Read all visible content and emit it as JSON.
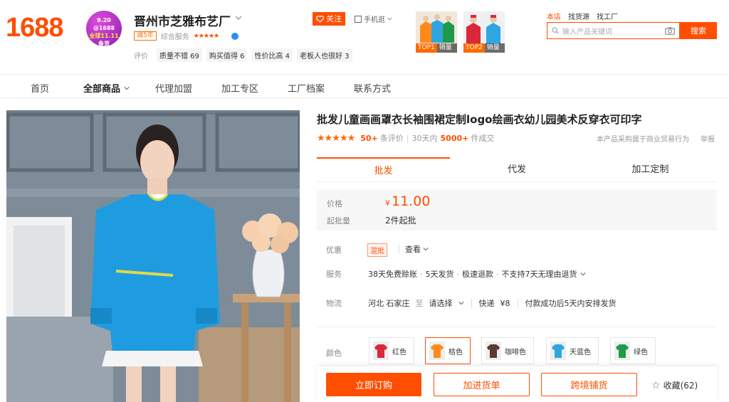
{
  "header": {
    "logo": "1688",
    "badge": {
      "line1": "9.20 @1688",
      "line2": "全球11.11",
      "line3": "备货"
    },
    "shop_name": "晋州市芝雅布艺厂",
    "years": "诚5年",
    "service_label": "综合服务",
    "rating_stars": "★★★★★",
    "review_label": "评价",
    "review_tags": [
      "质量不错 69",
      "购买值得 6",
      "性价比高 4",
      "老板人也很好 3"
    ],
    "follow_label": "关注",
    "mobile_label": "手机逛",
    "top_products": [
      {
        "rank": "TOP1",
        "sold": "销量"
      },
      {
        "rank": "TOP2",
        "sold": "销量"
      }
    ],
    "search_tabs": [
      "本店",
      "找货源",
      "找工厂"
    ],
    "search_placeholder": "输入产品关键词",
    "search_button": "搜索"
  },
  "nav": {
    "items": [
      "首页",
      "全部商品",
      "代理加盟",
      "加工专区",
      "工厂档案",
      "联系方式"
    ]
  },
  "product": {
    "title": "批发儿童画画罩衣长袖围裙定制logo绘画衣幼儿园美术反穿衣可印字",
    "stars": "★★★★★",
    "review_count": "50+",
    "review_unit": "条评价",
    "sales_prefix": "30天内",
    "sales_count": "5000+",
    "sales_unit": "件成交",
    "biz_note": "本产品采购属于商业贸易行为",
    "report": "举报",
    "tabs": [
      "批发",
      "代发",
      "加工定制"
    ],
    "price_label": "价格",
    "currency": "¥",
    "price": "11.00",
    "min_label": "起批量",
    "min_qty": "2件起批",
    "promo_label": "优惠",
    "promo_tag": "混批",
    "promo_view": "查看",
    "service_label": "服务",
    "services": [
      "38天免费赊账",
      "5天发货",
      "极速退款",
      "不支持7天无理由退货"
    ],
    "logistics_label": "物流",
    "origin": "河北 石家庄",
    "to": "至",
    "dest": "请选择",
    "express": "快递",
    "fee": "¥8",
    "ship_note": "付款成功后5天内安排发货",
    "color_label": "颜色",
    "colors": [
      {
        "name": "红色",
        "hex": "#d8283a"
      },
      {
        "name": "桔色",
        "hex": "#ff8a1c"
      },
      {
        "name": "咖啡色",
        "hex": "#5a3a2e"
      },
      {
        "name": "天蓝色",
        "hex": "#2fa6e0"
      },
      {
        "name": "绿色",
        "hex": "#1f9a4a"
      }
    ]
  },
  "actions": {
    "buy_now": "立即订购",
    "add_cart": "加进货单",
    "cross_border": "跨境铺货",
    "favorite": "收藏(62)"
  },
  "theme": {
    "accent": "#ff4e00"
  }
}
